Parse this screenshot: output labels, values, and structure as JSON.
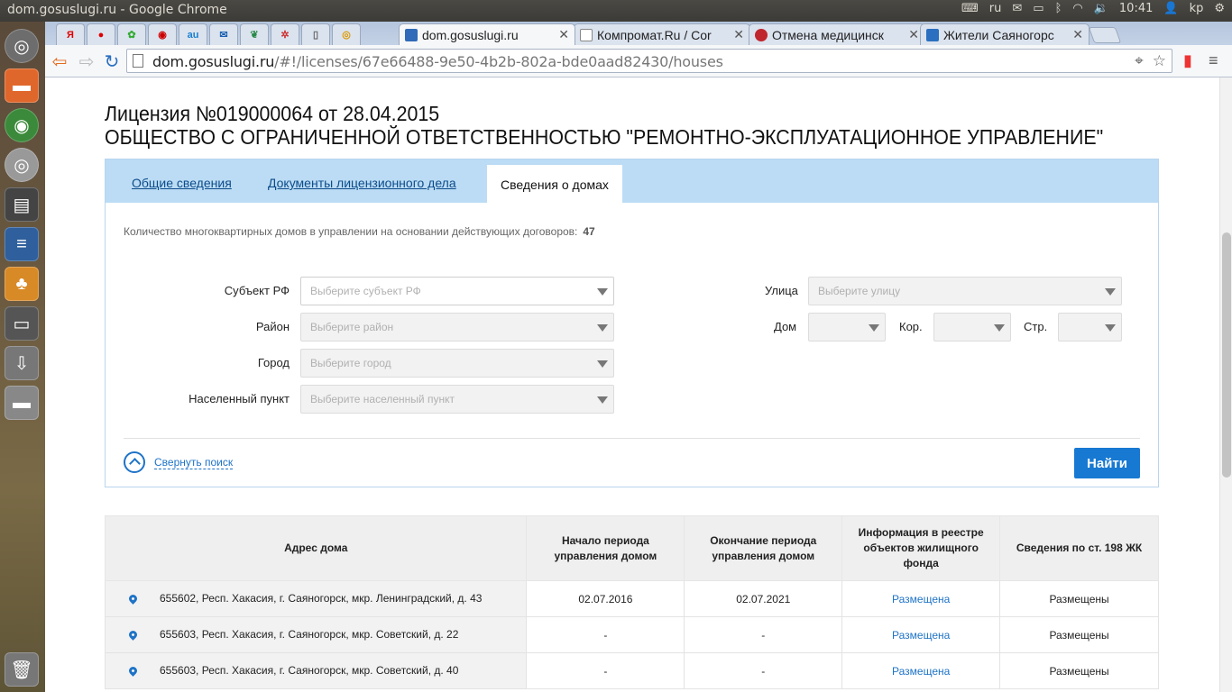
{
  "os": {
    "window_title": "dom.gosuslugi.ru - Google Chrome",
    "keyboard_layout": "ru",
    "clock": "10:41",
    "user": "kp"
  },
  "browser": {
    "tabs": [
      {
        "label": "dom.gosuslugi.ru",
        "active": true
      },
      {
        "label": "Компромат.Ru / Cor",
        "active": false
      },
      {
        "label": "Отмена медицинск",
        "active": false
      },
      {
        "label": "Жители Саяногорс",
        "active": false
      }
    ],
    "pinned_tab_icons": [
      "yandex-icon",
      "mail-icon",
      "apps-icon",
      "record-icon",
      "au-icon",
      "envelope-icon",
      "leaf-icon",
      "gear-icon",
      "page-icon",
      "ring-icon"
    ],
    "url_host": "dom.gosuslugi.ru",
    "url_path": "/#!/licenses/67e66488-9e50-4b2b-802a-bde0aad82430/houses"
  },
  "license": {
    "title": "Лицензия №019000064 от 28.04.2015",
    "org_name": "ОБЩЕСТВО С ОГРАНИЧЕННОЙ ОТВЕТСТВЕННОСТЬЮ \"РЕМОНТНО-ЭКСПЛУАТАЦИОННОЕ УПРАВЛЕНИЕ\""
  },
  "tabs": {
    "general": "Общие сведения",
    "documents": "Документы лицензионного дела",
    "houses": "Сведения о домах"
  },
  "summary": {
    "count_label": "Количество многоквартирных домов в управлении на основании действующих договоров:",
    "count_value": "47"
  },
  "filters": {
    "subject_label": "Субъект РФ",
    "subject_placeholder": "Выберите субъект РФ",
    "district_label": "Район",
    "district_placeholder": "Выберите район",
    "city_label": "Город",
    "city_placeholder": "Выберите город",
    "locality_label": "Населенный пункт",
    "locality_placeholder": "Выберите населенный пункт",
    "street_label": "Улица",
    "street_placeholder": "Выберите улицу",
    "house_label": "Дом",
    "building_label": "Кор.",
    "structure_label": "Стр.",
    "collapse_label": "Свернуть поиск",
    "find_label": "Найти"
  },
  "table": {
    "columns": {
      "address": "Адрес дома",
      "start": "Начало периода управления домом",
      "end": "Окончание периода управления домом",
      "registry": "Информация в реестре объектов жилищного фонда",
      "art198": "Сведения по ст. 198 ЖК"
    },
    "rows": [
      {
        "address": "655602, Респ. Хакасия, г. Саяногорск, мкр. Ленинградский, д. 43",
        "start": "02.07.2016",
        "end": "02.07.2021",
        "registry": "Размещена",
        "art198": "Размещены"
      },
      {
        "address": "655603, Респ. Хакасия, г. Саяногорск, мкр. Советский, д. 22",
        "start": "-",
        "end": "-",
        "registry": "Размещена",
        "art198": "Размещены"
      },
      {
        "address": "655603, Респ. Хакасия, г. Саяногорск, мкр. Советский, д. 40",
        "start": "-",
        "end": "-",
        "registry": "Размещена",
        "art198": "Размещены"
      }
    ]
  },
  "colors": {
    "accent": "#1779d2",
    "tab_bar": "#bbdcf4",
    "link": "#1e73c7"
  }
}
